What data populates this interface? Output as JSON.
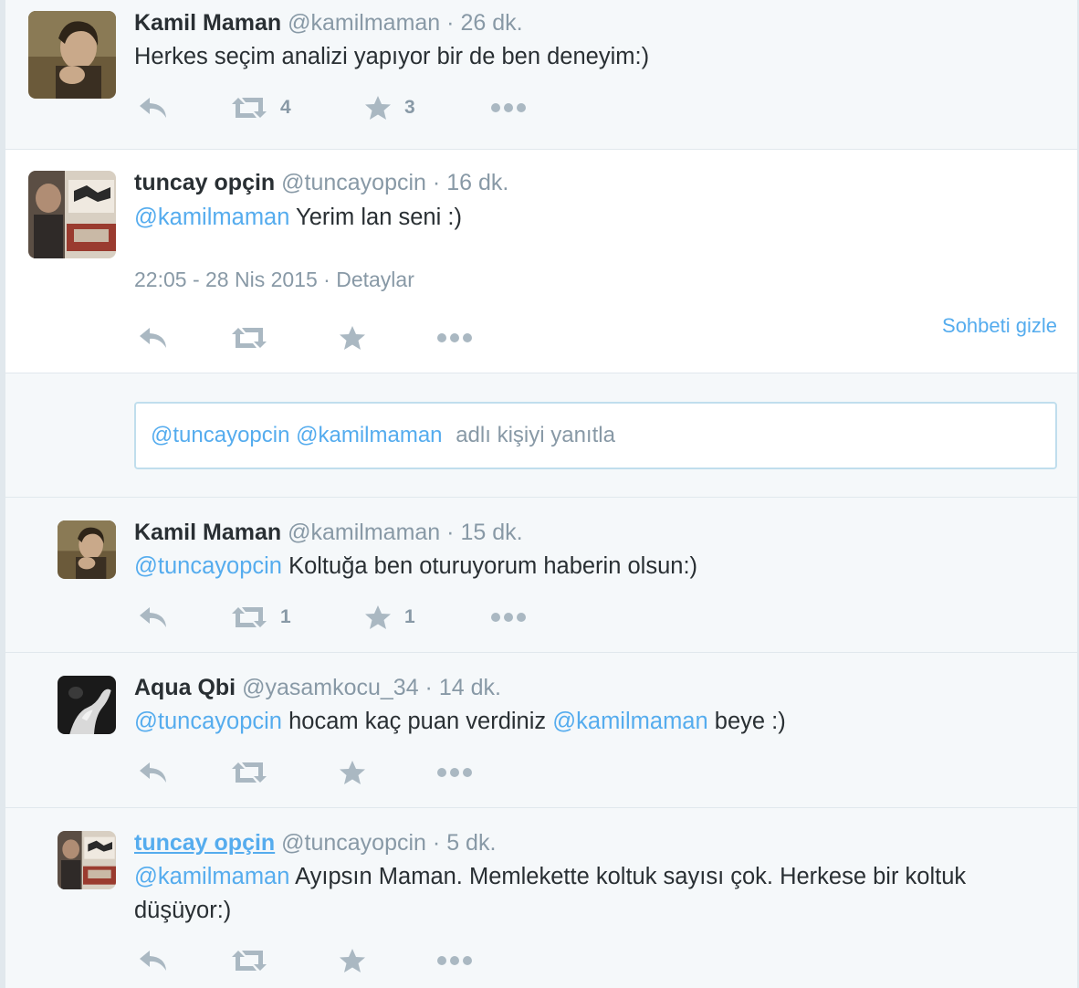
{
  "tweets": [
    {
      "fullname": "Kamil Maman",
      "screenname": "@kamilmaman",
      "sep": "·",
      "time": "26 dk.",
      "text": "Herkes seçim analizi yapıyor bir de ben deneyim:)",
      "retweets": "4",
      "favorites": "3",
      "avatar": "man-portrait-photo"
    },
    {
      "fullname": "tuncay opçin",
      "screenname": "@tuncayopcin",
      "sep": "·",
      "time": "16 dk.",
      "mention": "@kamilmaman",
      "text": "Yerim lan seni :)",
      "timestamp": "22:05 - 28 Nis 2015",
      "details_sep": "·",
      "details": "Detaylar",
      "hide_conversation": "Sohbeti gizle",
      "avatar": "man-photo-collage"
    },
    {
      "fullname": "Kamil Maman",
      "screenname": "@kamilmaman",
      "sep": "·",
      "time": "15 dk.",
      "mention": "@tuncayopcin",
      "text": "Koltuğa ben oturuyorum haberin olsun:)",
      "retweets": "1",
      "favorites": "1",
      "avatar": "man-portrait-photo"
    },
    {
      "fullname": "Aqua Qbi",
      "screenname": "@yasamkocu_34",
      "sep": "·",
      "time": "14 dk.",
      "mention": "@tuncayopcin",
      "text": "hocam kaç puan verdiniz",
      "mention2": "@kamilmaman",
      "text2": "beye :)",
      "avatar": "black-white-hand-photo"
    },
    {
      "fullname": "tuncay opçin",
      "screenname": "@tuncayopcin",
      "sep": "·",
      "time": "5 dk.",
      "mention": "@kamilmaman",
      "text": "Ayıpsın Maman. Memlekette koltuk sayısı çok. Herkese bir koltuk düşüyor:)",
      "avatar": "man-photo-collage"
    }
  ],
  "reply_box": {
    "mention1": "@tuncayopcin",
    "mention2": "@kamilmaman",
    "placeholder": "adlı kişiyi yanıtla"
  },
  "icons": [
    "reply-icon",
    "retweet-icon",
    "favorite-star-icon",
    "more-dots-icon"
  ],
  "colors": {
    "link": "#55acee",
    "muted": "#8899a6",
    "icon": "#aab8c2",
    "background": "#f5f8fa",
    "text": "#292f33"
  }
}
